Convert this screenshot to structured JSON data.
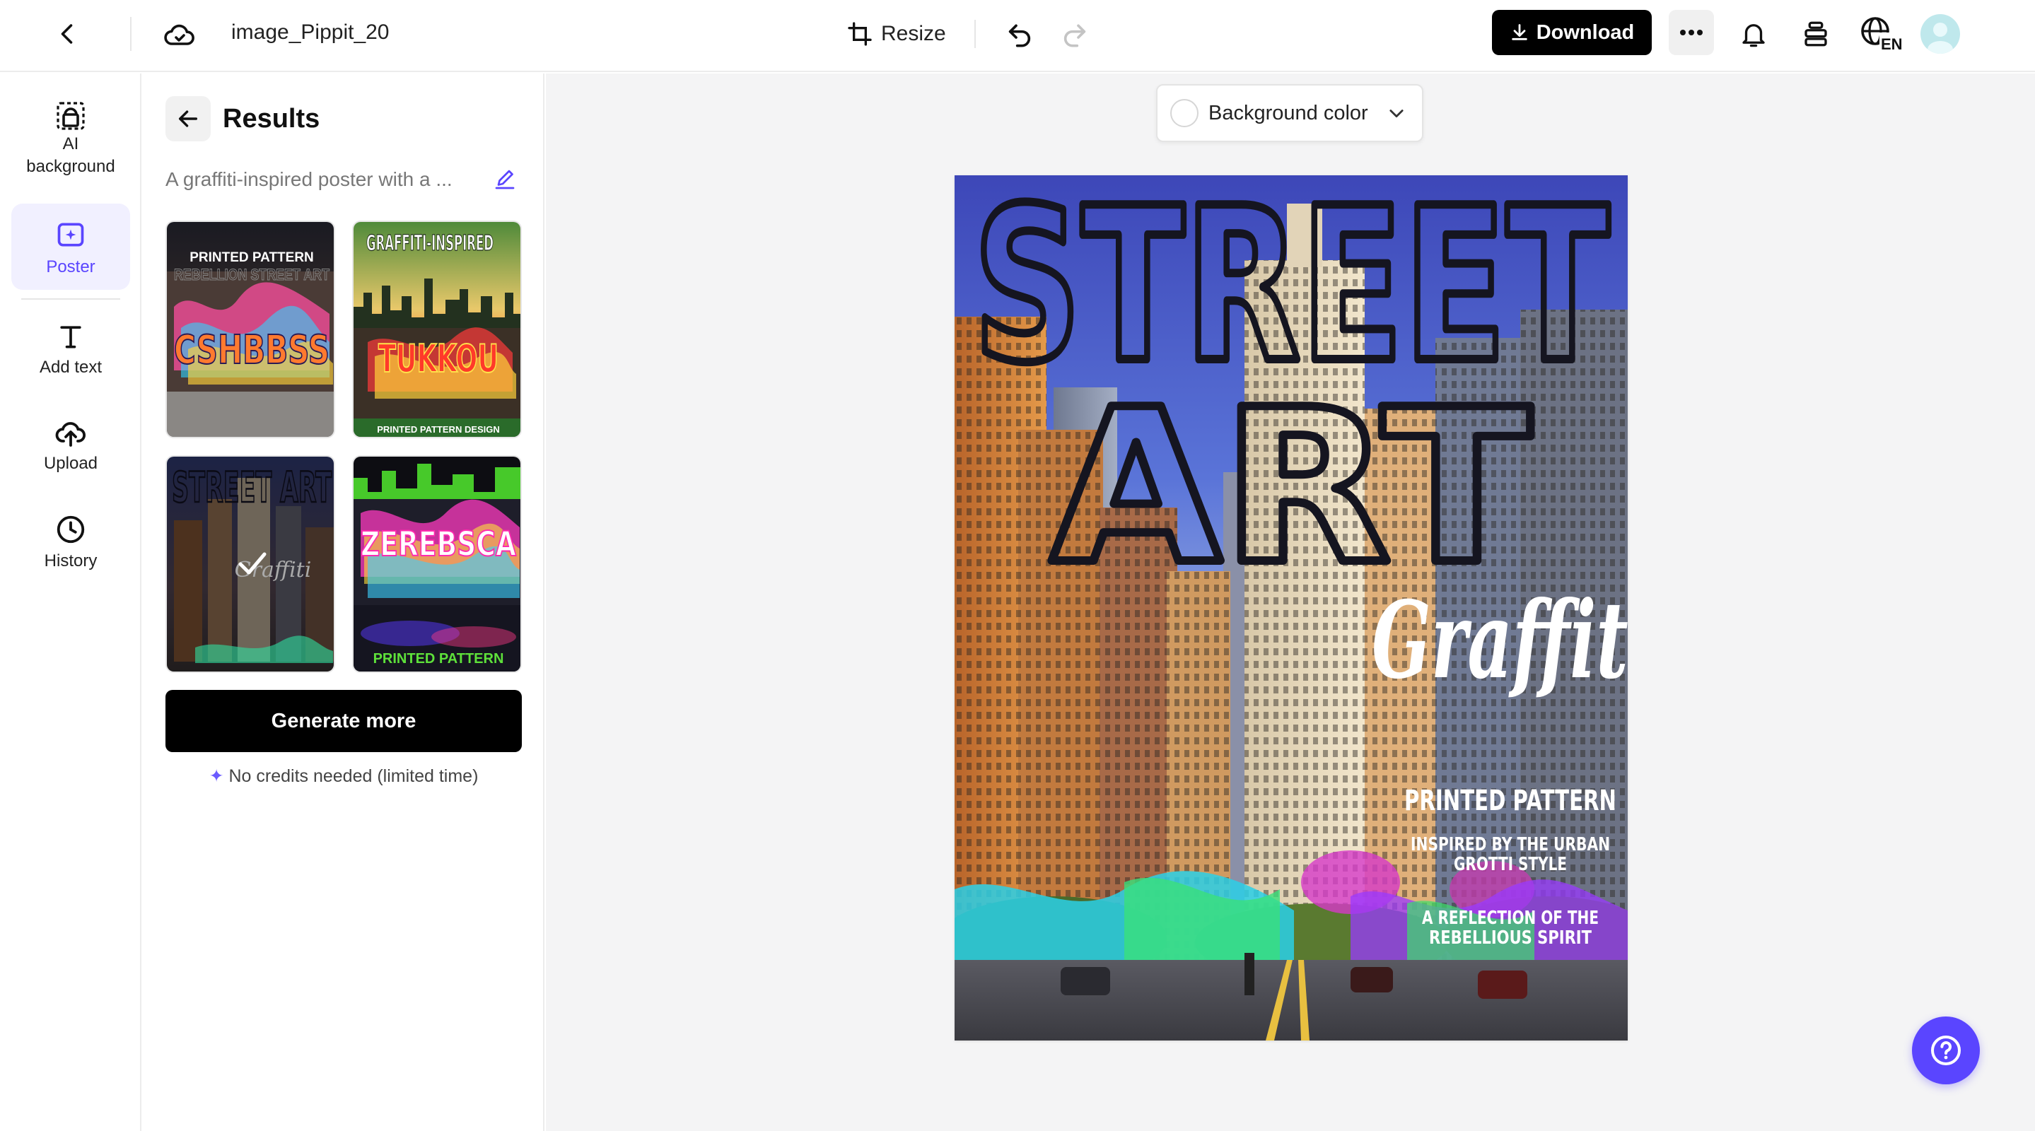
{
  "topbar": {
    "filename": "image_Pippit_20",
    "resize_label": "Resize",
    "download_label": "Download",
    "lang_badge": "EN"
  },
  "rail": {
    "items": [
      {
        "label": "AI background",
        "icon": "ai-background-icon"
      },
      {
        "label": "Poster",
        "icon": "poster-icon",
        "active": true
      },
      {
        "label": "Add text",
        "icon": "text-icon"
      },
      {
        "label": "Upload",
        "icon": "upload-icon"
      },
      {
        "label": "History",
        "icon": "history-icon"
      }
    ]
  },
  "panel": {
    "title": "Results",
    "prompt": "A graffiti-inspired poster with a ...",
    "thumbnails": [
      {
        "caption": "PRINTED PATTERN",
        "sub": "REBELLION STREET ART",
        "tag": "CSHBBSS"
      },
      {
        "caption": "GRAFFITI-INSPIRED",
        "sub": "PRINTED PATTERN DESIGN",
        "tag": "TUKKOU"
      },
      {
        "caption": "STREET ART",
        "sub": "Graffiti",
        "selected": true
      },
      {
        "caption": "PRINTED PATTERN",
        "tag": "ZEREBSCA"
      }
    ],
    "generate_label": "Generate more",
    "credits_note": "No credits needed (limited time)"
  },
  "canvas": {
    "background_color_label": "Background color",
    "poster": {
      "headline_1": "STREET",
      "headline_2": "ART",
      "script_word": "Graffiti",
      "line_1": "PRINTED PATTERN",
      "line_2a": "INSPIRED BY THE URBAN",
      "line_2b": "GROTTI STYLE",
      "line_3a": "A REFLECTION OF THE",
      "line_3b": "REBELLIOUS SPIRIT"
    }
  },
  "colors": {
    "accent": "#5a45ff",
    "black_button": "#000000",
    "canvas_bg": "#f4f4f5"
  }
}
